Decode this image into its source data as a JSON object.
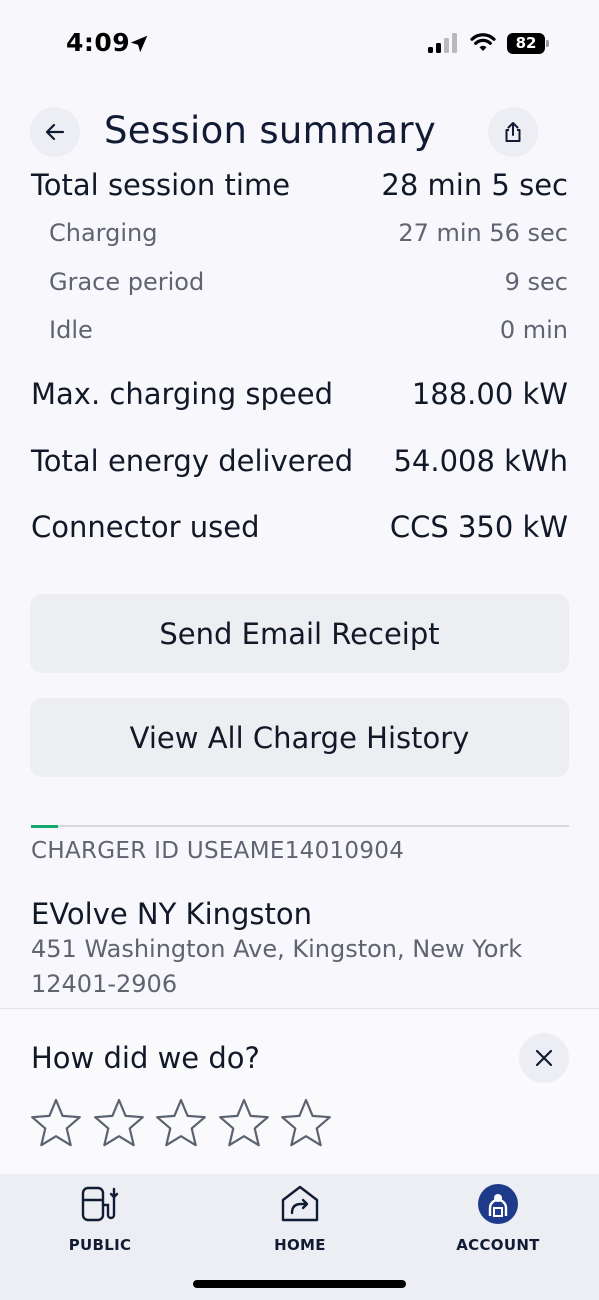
{
  "status_bar": {
    "time": "4:09",
    "battery": "82"
  },
  "header": {
    "title": "Session summary",
    "back_icon": "arrow-left-icon",
    "share_icon": "share-icon"
  },
  "summary": {
    "total_session_time": {
      "label": "Total session time",
      "value": "28 min 5 sec"
    },
    "breakdown": [
      {
        "label": "Charging",
        "value": "27 min 56 sec"
      },
      {
        "label": "Grace period",
        "value": "9 sec"
      },
      {
        "label": "Idle",
        "value": "0 min"
      }
    ],
    "max_speed": {
      "label": "Max. charging speed",
      "value": "188.00 kW"
    },
    "energy": {
      "label": "Total energy delivered",
      "value": "54.008 kWh"
    },
    "connector": {
      "label": "Connector used",
      "value": "CCS 350 kW"
    }
  },
  "actions": {
    "email_receipt": "Send Email Receipt",
    "charge_history": "View All Charge History"
  },
  "charger": {
    "id_text": "CHARGER ID USEAME14010904",
    "name": "EVolve NY Kingston",
    "address": "451 Washington Ave, Kingston, New York 12401-2906"
  },
  "rating": {
    "question": "How did we do?",
    "stars": 0,
    "max_stars": 5
  },
  "tabs": [
    {
      "label": "PUBLIC",
      "icon": "charging-station-icon"
    },
    {
      "label": "HOME",
      "icon": "home-charger-icon"
    },
    {
      "label": "ACCOUNT",
      "icon": "account-icon",
      "active": true
    }
  ],
  "colors": {
    "accent_green": "#13a86e",
    "navy": "#111b33",
    "account_active": "#1e3a8a"
  }
}
